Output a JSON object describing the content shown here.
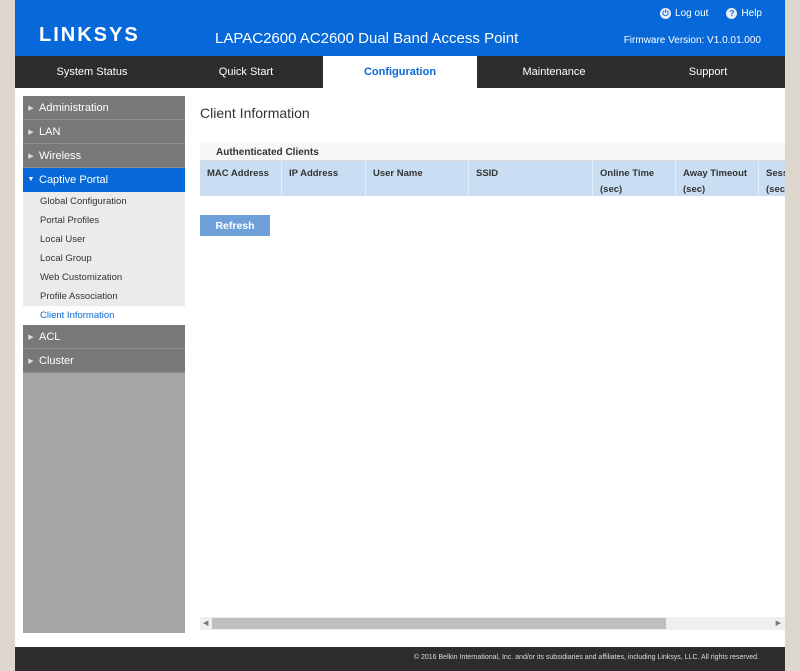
{
  "header": {
    "logo": "LINKSYS",
    "product_title": "LAPAC2600 AC2600 Dual Band Access Point",
    "logout_label": "Log out",
    "help_label": "Help",
    "firmware": "Firmware Version: V1.0.01.000",
    "brand_color": "#0668d9"
  },
  "nav": {
    "tabs": [
      {
        "label": "System Status"
      },
      {
        "label": "Quick Start"
      },
      {
        "label": "Configuration",
        "active": true
      },
      {
        "label": "Maintenance"
      },
      {
        "label": "Support"
      }
    ]
  },
  "sidebar": {
    "items": [
      {
        "label": "Administration"
      },
      {
        "label": "LAN"
      },
      {
        "label": "Wireless"
      },
      {
        "label": "Captive Portal",
        "expanded": true
      },
      {
        "label": "ACL"
      },
      {
        "label": "Cluster"
      }
    ],
    "captive_portal_sub": [
      {
        "label": "Global Configuration"
      },
      {
        "label": "Portal Profiles"
      },
      {
        "label": "Local User"
      },
      {
        "label": "Local Group"
      },
      {
        "label": "Web Customization"
      },
      {
        "label": "Profile Association"
      },
      {
        "label": "Client Information",
        "active": true
      }
    ]
  },
  "main": {
    "heading": "Client Information",
    "section_title": "Authenticated Clients",
    "columns": [
      {
        "line1": "MAC Address",
        "line2": ""
      },
      {
        "line1": "IP Address",
        "line2": ""
      },
      {
        "line1": "User Name",
        "line2": ""
      },
      {
        "line1": "SSID",
        "line2": ""
      },
      {
        "line1": "Online Time",
        "line2": "(sec)"
      },
      {
        "line1": "Away Timeout",
        "line2": "(sec)"
      },
      {
        "line1": "Session",
        "line2": "(sec)"
      }
    ],
    "rows": [],
    "refresh_label": "Refresh",
    "scroll_left_icon": "◀",
    "scroll_right_icon": "▶"
  },
  "footer": {
    "copyright": "© 2016 Belkin International, Inc. and/or its subsidiaries and affiliates, including Linksys, LLC. All rights reserved."
  }
}
